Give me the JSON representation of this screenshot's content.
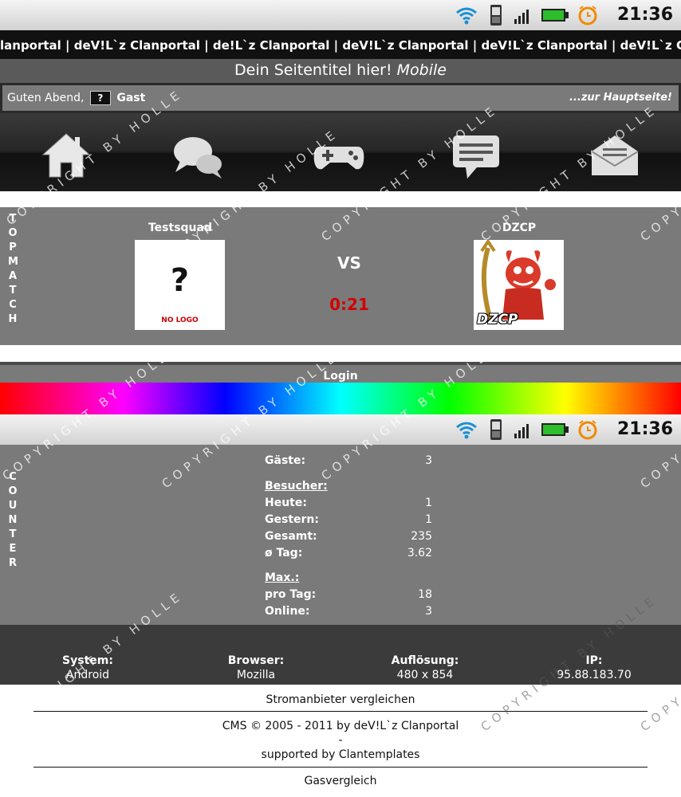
{
  "status_bar": {
    "time": "21:36"
  },
  "ticker": {
    "text": "lanportal | deV!L`z Clanportal | de!L`z Clanportal | deV!L`z Clanportal | deV!L`z Clanportal | deV!L`z Clanportal | deV!L`z"
  },
  "site_title": {
    "main": "Dein Seitentitel hier!",
    "sub": "Mobile"
  },
  "greeting": {
    "text": "Guten Abend,",
    "avatar": "?",
    "user": "Gast",
    "home_link": "...zur Hauptseite!"
  },
  "nav": {
    "icons": [
      "home-icon",
      "forum-icon",
      "gaming-icon",
      "chat-icon",
      "mail-icon"
    ]
  },
  "top_match": {
    "label": [
      "T",
      "O",
      "P",
      "",
      "M",
      "A",
      "T",
      "C",
      "H"
    ],
    "team1": {
      "name": "Testsquad",
      "logo_text": "?",
      "logo_caption": "NO LOGO"
    },
    "vs": "VS",
    "score": "0:21",
    "team2": {
      "name": "DZCP",
      "logo_caption": "DZCP"
    }
  },
  "login": {
    "label": "Login"
  },
  "counter": {
    "label": [
      "C",
      "O",
      "U",
      "N",
      "T",
      "E",
      "R"
    ],
    "gaeste": {
      "label": "Gäste:",
      "value": "3"
    },
    "besucher_heading": "Besucher:",
    "heute": {
      "label": "Heute:",
      "value": "1"
    },
    "gestern": {
      "label": "Gestern:",
      "value": "1"
    },
    "gesamt": {
      "label": "Gesamt:",
      "value": "235"
    },
    "tag": {
      "label": "ø Tag:",
      "value": "3.62"
    },
    "max_heading": "Max.:",
    "pro_tag": {
      "label": "pro Tag:",
      "value": "18"
    },
    "online": {
      "label": "Online:",
      "value": "3"
    }
  },
  "footer_info": {
    "system": {
      "label": "System:",
      "value": "Android"
    },
    "browser": {
      "label": "Browser:",
      "value": "Mozilla"
    },
    "aufloesung": {
      "label": "Auflösung:",
      "value": "480 x 854"
    },
    "ip": {
      "label": "IP:",
      "value": "95.88.183.70"
    }
  },
  "footer_links": {
    "strom": "Stromanbieter vergleichen",
    "cms": "CMS © 2005 - 2011 by deV!L`z Clanportal",
    "dash": "-",
    "supported": "supported by Clantemplates",
    "gas": "Gasvergleich"
  },
  "watermark": "COPYRIGHT BY HOLLE"
}
